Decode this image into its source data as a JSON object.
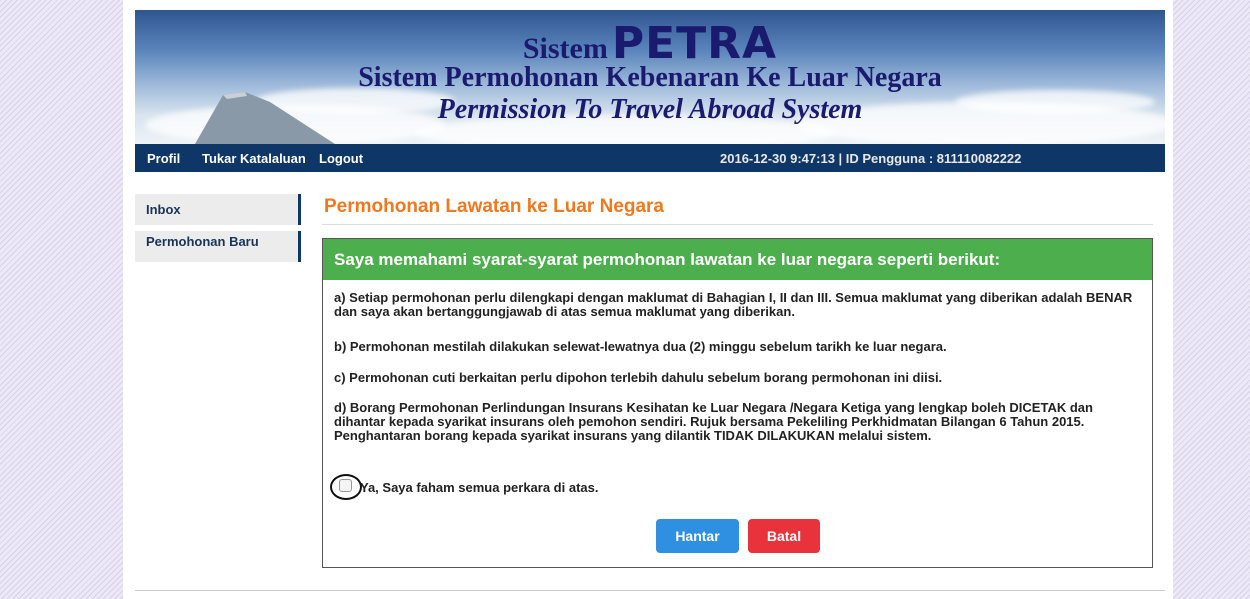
{
  "banner": {
    "line1_prefix": "Sistem",
    "line1_brand": "PETRA",
    "line2": "Sistem Permohonan Kebenaran Ke Luar Negara",
    "line3": "Permission To Travel Abroad System"
  },
  "navbar": {
    "links": [
      "Profil",
      "Tukar Katalaluan",
      "Logout"
    ],
    "session_info": "2016-12-30 9:47:13 | ID Pengguna : 811110082222"
  },
  "sidebar": {
    "items": [
      {
        "label": "Inbox"
      },
      {
        "label": "Permohonan Baru"
      }
    ]
  },
  "main": {
    "title": "Permohonan Lawatan ke Luar Negara",
    "panel": {
      "heading": "Saya memahami syarat-syarat permohonan lawatan ke luar negara seperti berikut:",
      "paragraphs": [
        "a) Setiap permohonan perlu dilengkapi dengan maklumat di Bahagian I, II dan III. Semua maklumat yang diberikan adalah BENAR dan saya akan bertanggungjawab di atas semua maklumat yang diberikan.",
        "b) Permohonan mestilah dilakukan selewat-lewatnya dua (2) minggu sebelum tarikh ke luar negara.",
        "c) Permohonan cuti berkaitan perlu dipohon terlebih dahulu sebelum borang permohonan ini diisi.",
        "d) Borang Permohonan Perlindungan Insurans Kesihatan ke Luar Negara /Negara Ketiga yang lengkap boleh DICETAK dan dihantar kepada syarikat insurans oleh pemohon sendiri. Rujuk bersama Pekeliling Perkhidmatan Bilangan 6 Tahun 2015. Penghantaran borang kepada syarikat insurans yang dilantik TIDAK DILAKUKAN melalui sistem."
      ],
      "agree_label": "Ya, Saya faham semua perkara di atas.",
      "agree_checked": false,
      "buttons": {
        "submit_label": "Hantar",
        "cancel_label": "Batal"
      }
    }
  },
  "colors": {
    "navbar_bg": "#0e3666",
    "title": "#f0781e",
    "panel_head": "#4cae4c",
    "submit": "#2f8fe0",
    "cancel": "#e8323c"
  }
}
